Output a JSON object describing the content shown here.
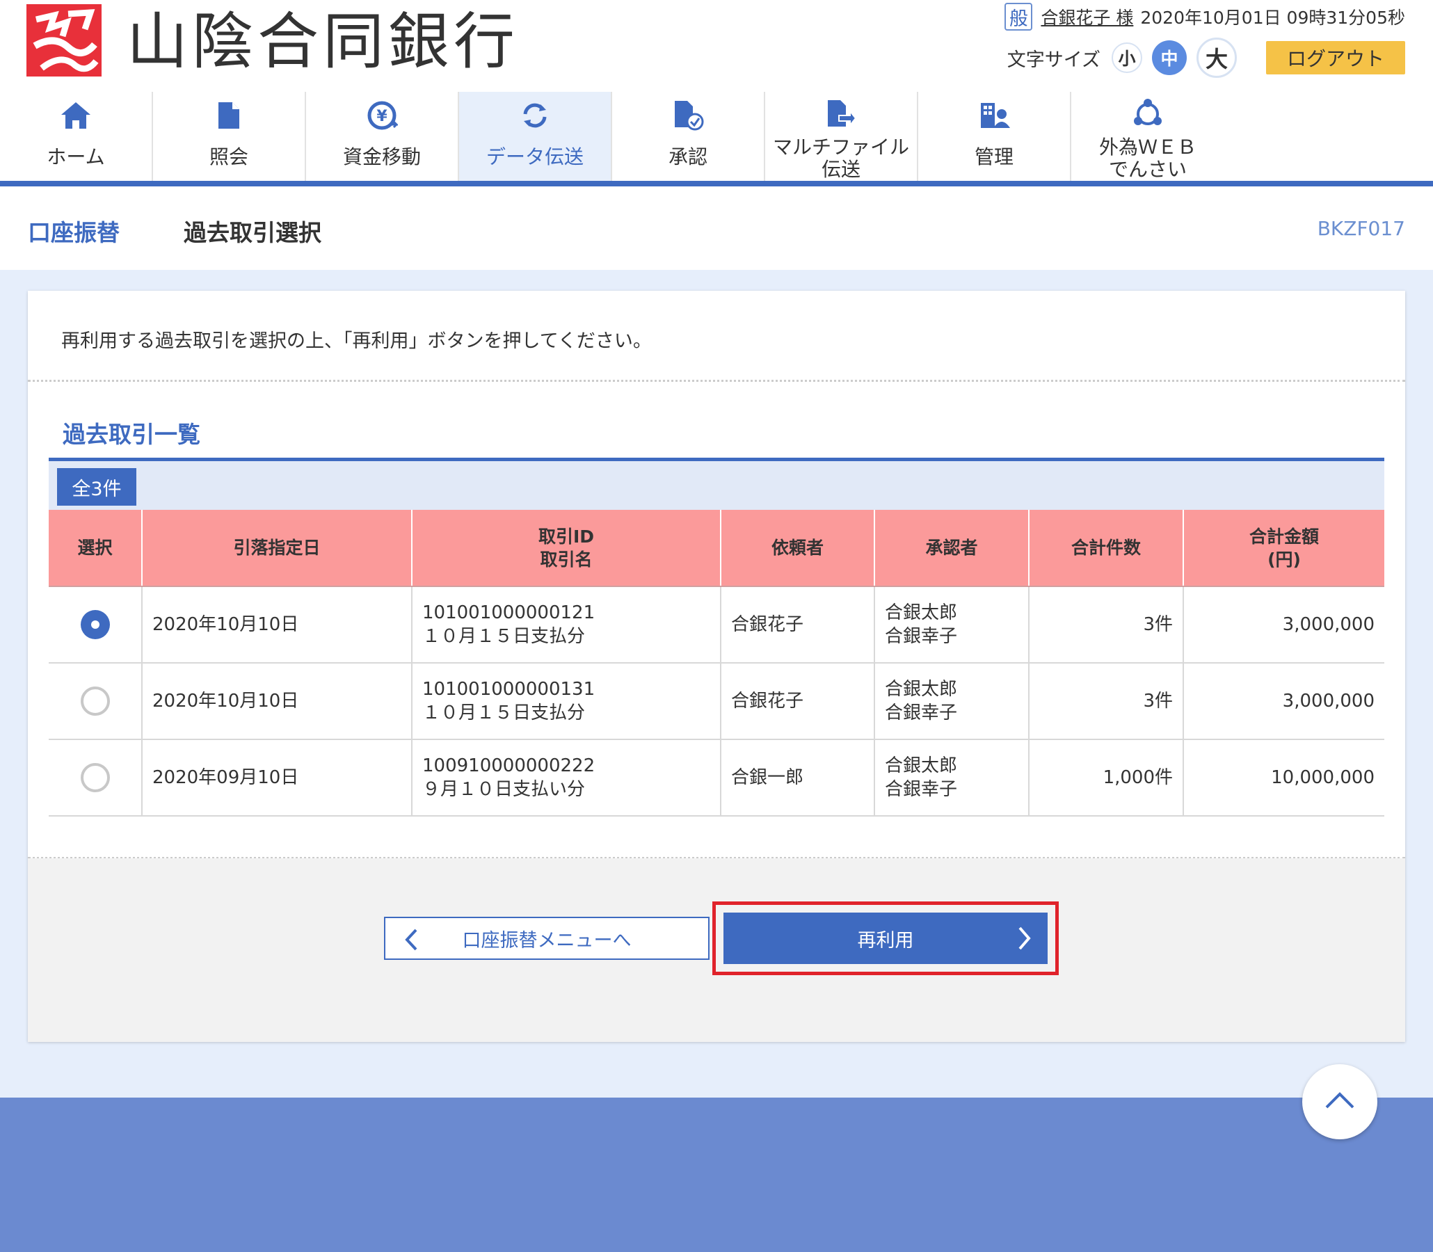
{
  "header": {
    "bank_name": "山陰合同銀行",
    "role_badge": "般",
    "user_name": "合銀花子 様",
    "datetime": "2020年10月01日 09時31分05秒",
    "font_size_label": "文字サイズ",
    "font_small": "小",
    "font_medium": "中",
    "font_large": "大",
    "logout": "ログアウト"
  },
  "nav": {
    "items": [
      {
        "label": "ホーム",
        "icon": "home-icon"
      },
      {
        "label": "照会",
        "icon": "document-icon"
      },
      {
        "label": "資金移動",
        "icon": "yen-transfer-icon"
      },
      {
        "label": "データ伝送",
        "icon": "sync-icon"
      },
      {
        "label": "承認",
        "icon": "approve-icon"
      },
      {
        "label_1": "マルチファイル",
        "label_2": "伝送",
        "icon": "multi-file-icon"
      },
      {
        "label": "管理",
        "icon": "admin-icon"
      },
      {
        "label_1": "外為ＷＥＢ",
        "label_2": "でんさい",
        "icon": "network-icon"
      }
    ],
    "active": "データ伝送"
  },
  "title": {
    "main": "口座振替",
    "sub": "過去取引選択",
    "screen_id": "BKZF017"
  },
  "content": {
    "instruction": "再利用する過去取引を選択の上、「再利用」ボタンを押してください。",
    "section_title": "過去取引一覧",
    "count": "全3件"
  },
  "table": {
    "headers": {
      "select": "選択",
      "date": "引落指定日",
      "id_1": "取引ID",
      "id_2": "取引名",
      "requester": "依頼者",
      "approver": "承認者",
      "count": "合計件数",
      "amount_1": "合計金額",
      "amount_2": "(円)"
    },
    "rows": [
      {
        "checked": true,
        "date": "2020年10月10日",
        "id": "101001000000121",
        "name": "１０月１５日支払分",
        "requester": "合銀花子",
        "approver_1": "合銀太郎",
        "approver_2": "合銀幸子",
        "count": "3件",
        "amount": "3,000,000"
      },
      {
        "checked": false,
        "date": "2020年10月10日",
        "id": "101001000000131",
        "name": "１０月１５日支払分",
        "requester": "合銀花子",
        "approver_1": "合銀太郎",
        "approver_2": "合銀幸子",
        "count": "3件",
        "amount": "3,000,000"
      },
      {
        "checked": false,
        "date": "2020年09月10日",
        "id": "100910000000222",
        "name": "９月１０日支払い分",
        "requester": "合銀一郎",
        "approver_1": "合銀太郎",
        "approver_2": "合銀幸子",
        "count": "1,000件",
        "amount": "10,000,000"
      }
    ]
  },
  "buttons": {
    "back": "口座振替メニューへ",
    "reuse": "再利用"
  },
  "colors": {
    "primary": "#3e6ac0",
    "header_pink": "#fb9a9a",
    "logout_yellow": "#f5c247",
    "highlight_red": "#e0232b",
    "footer": "#6b8ad0"
  }
}
